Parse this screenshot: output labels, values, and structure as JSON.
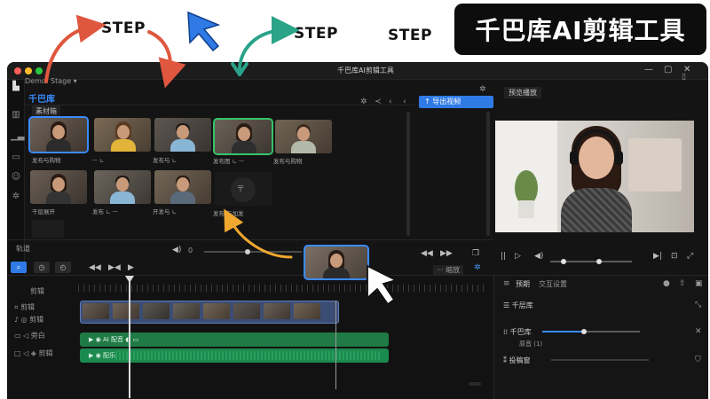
{
  "banner": {
    "step1": "STEP",
    "step2": "STEP",
    "step3": "STEP",
    "title": "千巴库AI剪辑工具"
  },
  "window": {
    "title": "千巴库AI剪辑工具",
    "project_button": "Demo: Stage",
    "library_title": "千巴库",
    "media_tab": "素材箱",
    "export_button": "导出视频"
  },
  "media": [
    {
      "caption": "发布与购物"
    },
    {
      "caption": "  ᅳ  ∟"
    },
    {
      "caption": "发布与 ∟"
    },
    {
      "caption": "发布图 ∟ ᅳ"
    },
    {
      "caption": "发布与购物"
    },
    {
      "caption": "干层展开"
    },
    {
      "caption": "发布 ∟ ᅳ"
    },
    {
      "caption": "开发与 ∟"
    },
    {
      "caption": "发布 与加发"
    }
  ],
  "preview": {
    "title": "预览播放"
  },
  "transport": {
    "zoom_value": "0",
    "timeline_label": "轨道",
    "zoom_hint": "··· 缩放"
  },
  "timeline": {
    "track_title": "剪辑",
    "track_video": "剪辑",
    "track_audio1": "剪辑",
    "track_audio2": "剪辑",
    "track_text": "旁白",
    "audio1_label": "AI 配音",
    "audio2_label": "配乐"
  },
  "properties": {
    "tab1": "预期",
    "tab2": "交互设置",
    "row1": "千层库",
    "row2": "千巴库",
    "row2_sub": "原音 (1)",
    "row3": "投稿窗"
  },
  "colors": {
    "accent": "#2f7ae5",
    "green": "#35c46a",
    "window_bg": "#141414",
    "badge_bg": "#0d0d0d"
  }
}
